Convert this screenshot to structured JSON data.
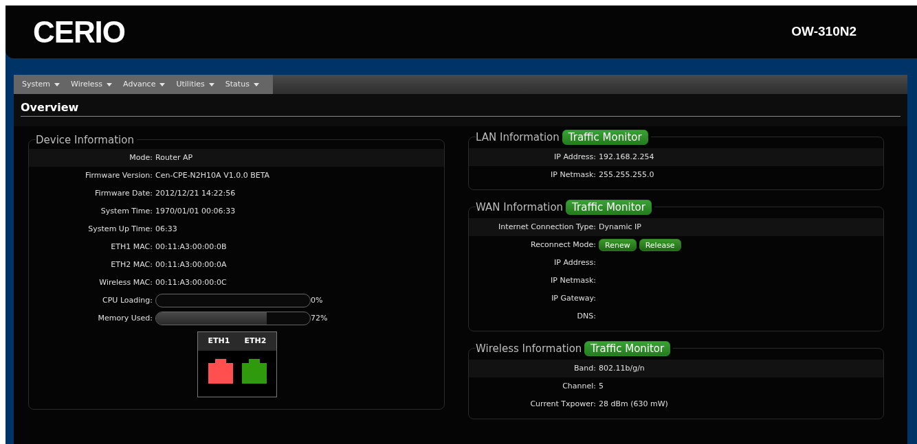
{
  "header": {
    "logo": "CERIO",
    "model": "OW-310N2"
  },
  "menu": [
    {
      "label": "System"
    },
    {
      "label": "Wireless"
    },
    {
      "label": "Advance"
    },
    {
      "label": "Utilities"
    },
    {
      "label": "Status"
    }
  ],
  "page_title": "Overview",
  "device_info": {
    "title": "Device Information",
    "rows": [
      {
        "kind": "text",
        "label": "Mode:",
        "value": "Router AP"
      },
      {
        "kind": "text",
        "label": "Firmware Version:",
        "value": "Cen-CPE-N2H10A V1.0.0 BETA"
      },
      {
        "kind": "text",
        "label": "Firmware Date:",
        "value": "2012/12/21 14:22:56"
      },
      {
        "kind": "text",
        "label": "System Time:",
        "value": "1970/01/01 00:06:33"
      },
      {
        "kind": "text",
        "label": "System Up Time:",
        "value": "06:33"
      },
      {
        "kind": "text",
        "label": "ETH1 MAC:",
        "value": "00:11:A3:00:00:0B"
      },
      {
        "kind": "text",
        "label": "ETH2 MAC:",
        "value": "00:11:A3:00:00:0A"
      },
      {
        "kind": "text",
        "label": "Wireless MAC:",
        "value": "00:11:A3:00:00:0C"
      },
      {
        "kind": "meter",
        "label": "CPU Loading:",
        "level": 0,
        "reading": "0%"
      },
      {
        "kind": "meter",
        "label": "Memory Used:",
        "level": 0.72,
        "reading": "72%"
      }
    ],
    "ports": [
      {
        "label": "ETH1",
        "color": "#ff4f4f"
      },
      {
        "label": "ETH2",
        "color": "#2e9a0c"
      }
    ]
  },
  "sections": [
    {
      "title": "LAN Information",
      "button": "Traffic Monitor",
      "rows": [
        {
          "label": "IP Address:",
          "value": "192.168.2.254"
        },
        {
          "label": "IP Netmask:",
          "value": "255.255.255.0"
        }
      ]
    },
    {
      "title": "WAN Information",
      "button": "Traffic Monitor",
      "rows": [
        {
          "label": "Internet Connection Type:",
          "value": "Dynamic IP"
        },
        {
          "label": "Reconnect Mode:",
          "buttons": [
            "Renew",
            "Release"
          ]
        },
        {
          "label": "IP Address:"
        },
        {
          "label": "IP Netmask:"
        },
        {
          "label": "IP Gateway:"
        },
        {
          "label": "DNS:"
        }
      ]
    },
    {
      "title": "Wireless Information",
      "button": "Traffic Monitor",
      "rows": [
        {
          "label": "Band:",
          "value": "802.11b/g/n"
        },
        {
          "label": "Channel:",
          "value": "5"
        },
        {
          "label": "Current Txpower:",
          "value": "28 dBm (630 mW)"
        }
      ]
    }
  ]
}
